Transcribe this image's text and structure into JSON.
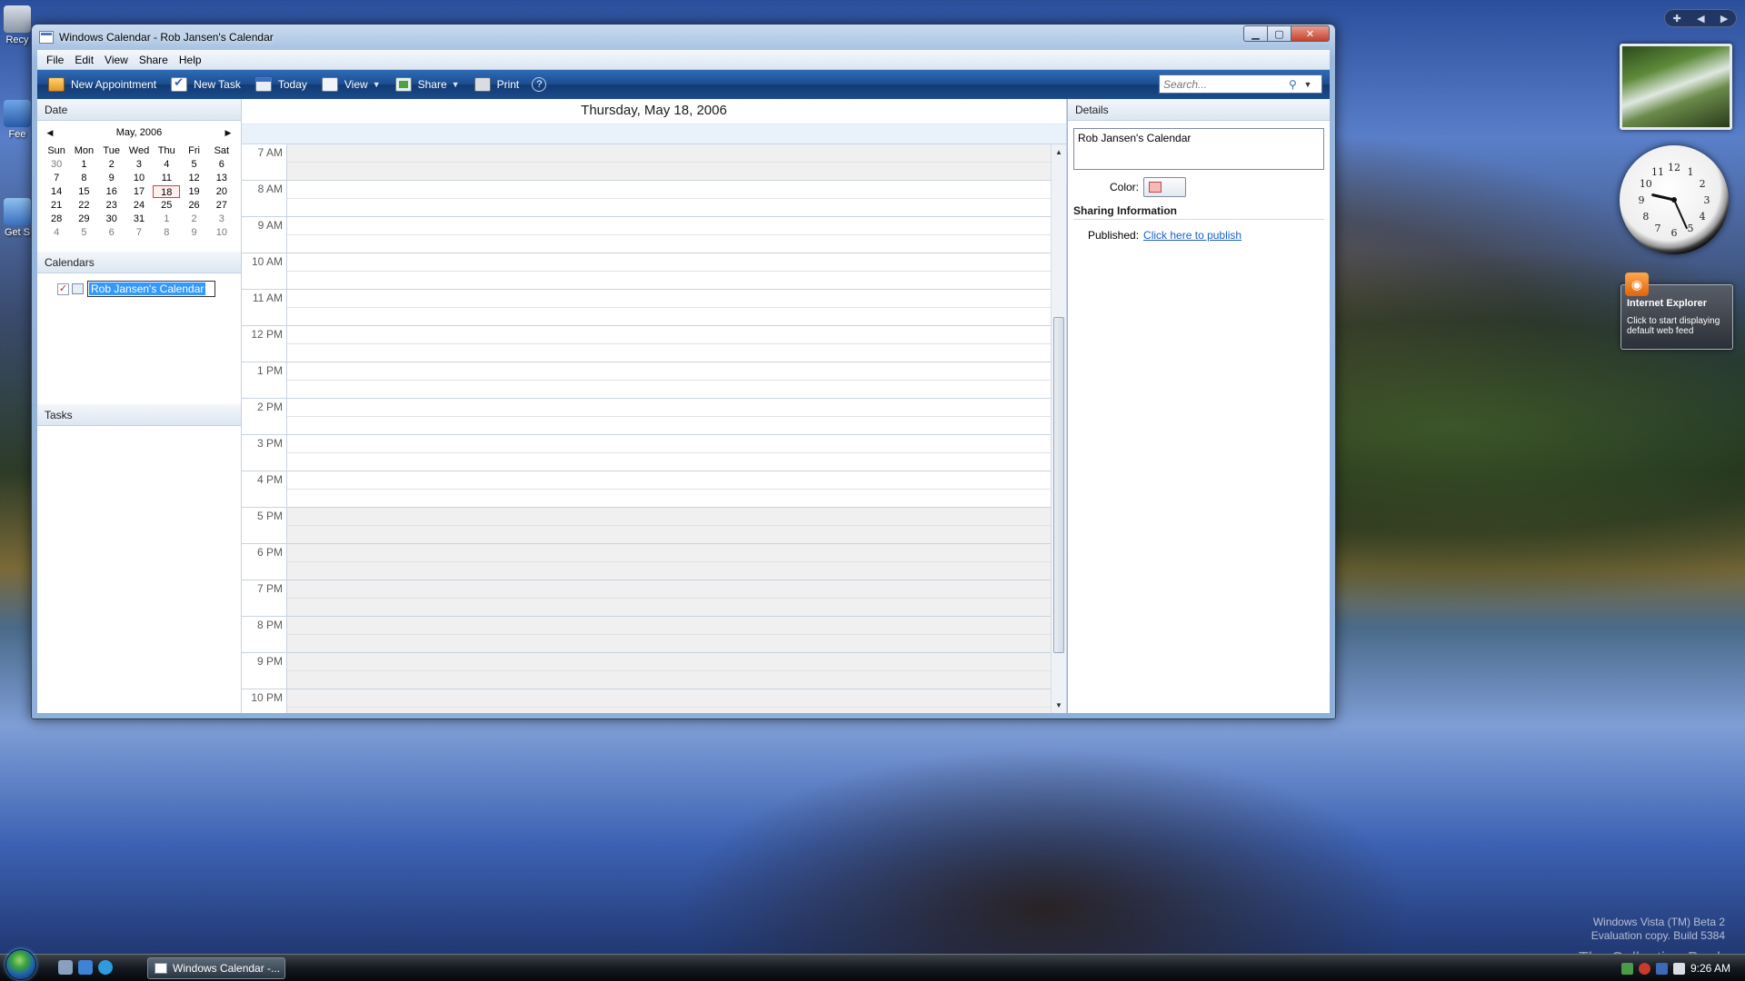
{
  "desktop": {
    "icons": [
      {
        "label": "Recy"
      },
      {
        "label": "Fee"
      },
      {
        "label": "Get S"
      }
    ]
  },
  "window": {
    "title": "Windows Calendar - Rob Jansen's Calendar",
    "menu": [
      "File",
      "Edit",
      "View",
      "Share",
      "Help"
    ],
    "toolbar": {
      "new_appointment": "New Appointment",
      "new_task": "New Task",
      "today": "Today",
      "view": "View",
      "share": "Share",
      "print": "Print",
      "help": "?",
      "search_placeholder": "Search..."
    }
  },
  "left_pane": {
    "date_header": "Date",
    "mini_calendar": {
      "month_label": "May, 2006",
      "weekdays": [
        "Sun",
        "Mon",
        "Tue",
        "Wed",
        "Thu",
        "Fri",
        "Sat"
      ],
      "weeks": [
        [
          "30",
          "1",
          "2",
          "3",
          "4",
          "5",
          "6"
        ],
        [
          "7",
          "8",
          "9",
          "10",
          "11",
          "12",
          "13"
        ],
        [
          "14",
          "15",
          "16",
          "17",
          "18",
          "19",
          "20"
        ],
        [
          "21",
          "22",
          "23",
          "24",
          "25",
          "26",
          "27"
        ],
        [
          "28",
          "29",
          "30",
          "31",
          "1",
          "2",
          "3"
        ],
        [
          "4",
          "5",
          "6",
          "7",
          "8",
          "9",
          "10"
        ]
      ],
      "selected_day": "18"
    },
    "calendars_header": "Calendars",
    "calendars": [
      {
        "name": "Rob Jansen's Calendar",
        "checked": true
      }
    ],
    "tasks_header": "Tasks"
  },
  "day_view": {
    "date_title": "Thursday, May 18, 2006",
    "hours": [
      "7 AM",
      "8 AM",
      "9 AM",
      "10 AM",
      "11 AM",
      "12 PM",
      "1 PM",
      "2 PM",
      "3 PM",
      "4 PM",
      "5 PM",
      "6 PM",
      "7 PM",
      "8 PM",
      "9 PM",
      "10 PM"
    ],
    "work_hours": [
      "8 AM",
      "9 AM",
      "10 AM",
      "11 AM",
      "12 PM",
      "1 PM",
      "2 PM",
      "3 PM",
      "4 PM"
    ]
  },
  "details": {
    "header": "Details",
    "calendar_name": "Rob Jansen's Calendar",
    "color_label": "Color:",
    "color_value": "#f7b8b8",
    "sharing_title": "Sharing Information",
    "published_label": "Published:",
    "publish_link": "Click here to publish"
  },
  "gadgets": {
    "feed_title": "Internet Explorer",
    "feed_message": "Click to start displaying default web feed",
    "clock": {
      "hour": 9,
      "minute": 26
    }
  },
  "watermark": {
    "line1": "Windows Vista (TM) Beta 2",
    "line2": "Evaluation copy. Build 5384",
    "brand": "The Collection Book"
  },
  "taskbar": {
    "window_button": "Windows Calendar -...",
    "time": "9:26 AM"
  }
}
